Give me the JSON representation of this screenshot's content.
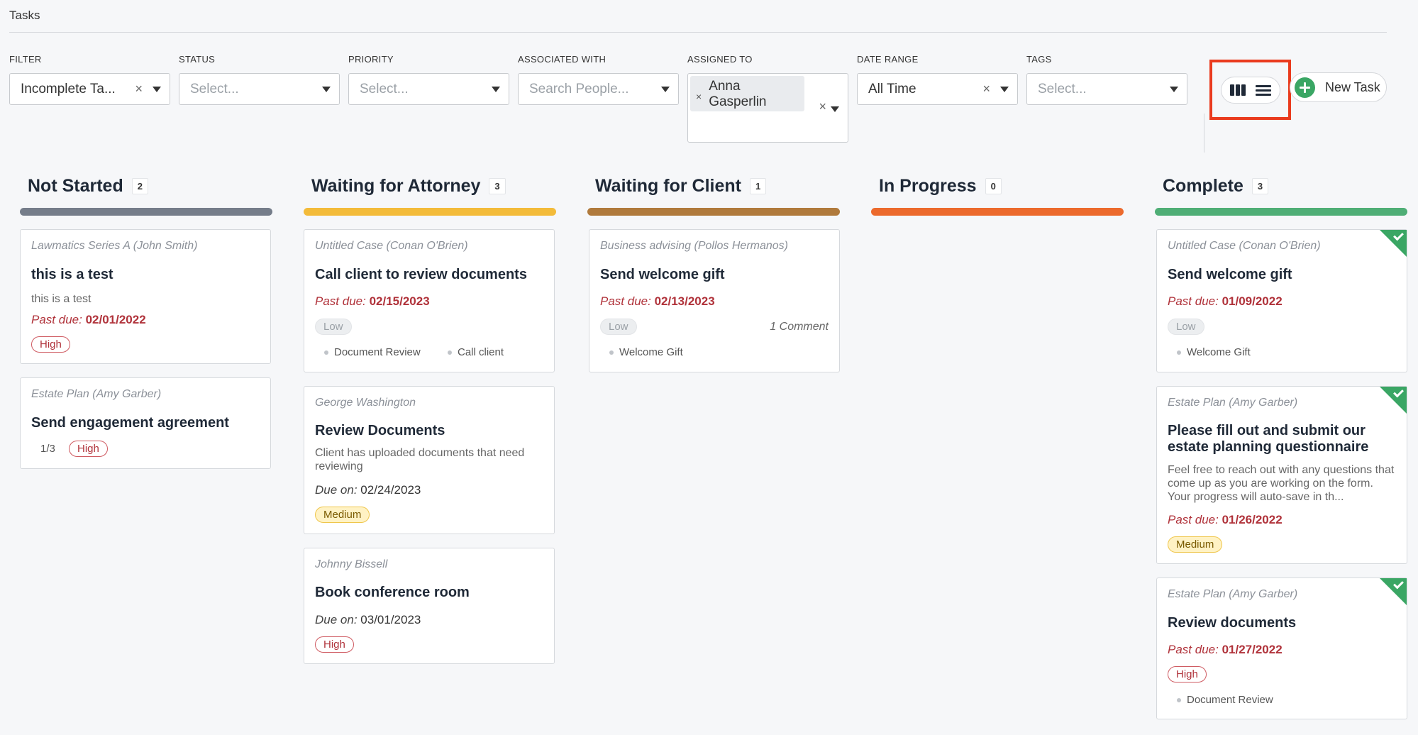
{
  "page": {
    "title": "Tasks"
  },
  "filters": {
    "filter": {
      "label": "FILTER",
      "value": "Incomplete Ta..."
    },
    "status": {
      "label": "STATUS",
      "placeholder": "Select..."
    },
    "priority": {
      "label": "PRIORITY",
      "placeholder": "Select..."
    },
    "associated": {
      "label": "ASSOCIATED WITH",
      "placeholder": "Search People..."
    },
    "assigned": {
      "label": "ASSIGNED TO",
      "chip_line1": "Anna",
      "chip_line2": "Gasperlin"
    },
    "date_range": {
      "label": "DATE RANGE",
      "value": "All Time"
    },
    "tags": {
      "label": "TAGS",
      "placeholder": "Select..."
    },
    "clear_glyph": "×"
  },
  "view_toggle": {
    "board_icon": "columns-icon",
    "list_icon": "list-icon",
    "highlight_color": "#ea3b1e"
  },
  "new_task": {
    "label": "New Task"
  },
  "labels": {
    "past_due": "Past due:",
    "due_on": "Due on:"
  },
  "columns": [
    {
      "title": "Not Started",
      "count": "2",
      "color": "#757d8a",
      "cards": [
        {
          "matter": "Lawmatics Series A (John Smith)",
          "title": "this is a test",
          "desc": "this is a test",
          "due_label": "Past due:",
          "due_date": "02/01/2022",
          "priority": "High"
        },
        {
          "matter": "Estate Plan (Amy Garber)",
          "title": "Send engagement agreement",
          "subtasks": "1/3",
          "priority": "High"
        }
      ]
    },
    {
      "title": "Waiting for Attorney",
      "count": "3",
      "color": "#f3bb3a",
      "cards": [
        {
          "matter": "Untitled Case (Conan O'Brien)",
          "title": "Call client to review documents",
          "due_label": "Past due:",
          "due_date": "02/15/2023",
          "priority": "Low",
          "tags": [
            "Document Review",
            "Call client"
          ]
        },
        {
          "matter": "George Washington",
          "title": "Review Documents",
          "desc": "Client has uploaded documents that need reviewing",
          "due_label": "Due on:",
          "due_date": "02/24/2023",
          "priority": "Medium"
        },
        {
          "matter": "Johnny Bissell",
          "title": "Book conference room",
          "due_label": "Due on:",
          "due_date": "03/01/2023",
          "priority": "High"
        }
      ]
    },
    {
      "title": "Waiting for Client",
      "count": "1",
      "color": "#b07a3c",
      "cards": [
        {
          "matter": "Business advising (Pollos Hermanos)",
          "title": "Send welcome gift",
          "due_label": "Past due:",
          "due_date": "02/13/2023",
          "priority": "Low",
          "comments": "1 Comment",
          "tags": [
            "Welcome Gift"
          ]
        }
      ]
    },
    {
      "title": "In Progress",
      "count": "0",
      "color": "#ec6a2d",
      "cards": []
    },
    {
      "title": "Complete",
      "count": "3",
      "color": "#4fae76",
      "cards": [
        {
          "matter": "Untitled Case (Conan O'Brien)",
          "title": "Send welcome gift",
          "due_label": "Past due:",
          "due_date": "01/09/2022",
          "priority": "Low",
          "tags": [
            "Welcome Gift"
          ]
        },
        {
          "matter": "Estate Plan (Amy Garber)",
          "title": "Please fill out and submit our estate planning questionnaire",
          "desc": "Feel free to reach out with any questions that come up as you are working on the form. Your progress will auto-save in th...",
          "due_label": "Past due:",
          "due_date": "01/26/2022",
          "priority": "Medium"
        },
        {
          "matter": "Estate Plan (Amy Garber)",
          "title": "Review documents",
          "due_label": "Past due:",
          "due_date": "01/27/2022",
          "priority": "High",
          "tags": [
            "Document Review"
          ]
        }
      ]
    }
  ]
}
